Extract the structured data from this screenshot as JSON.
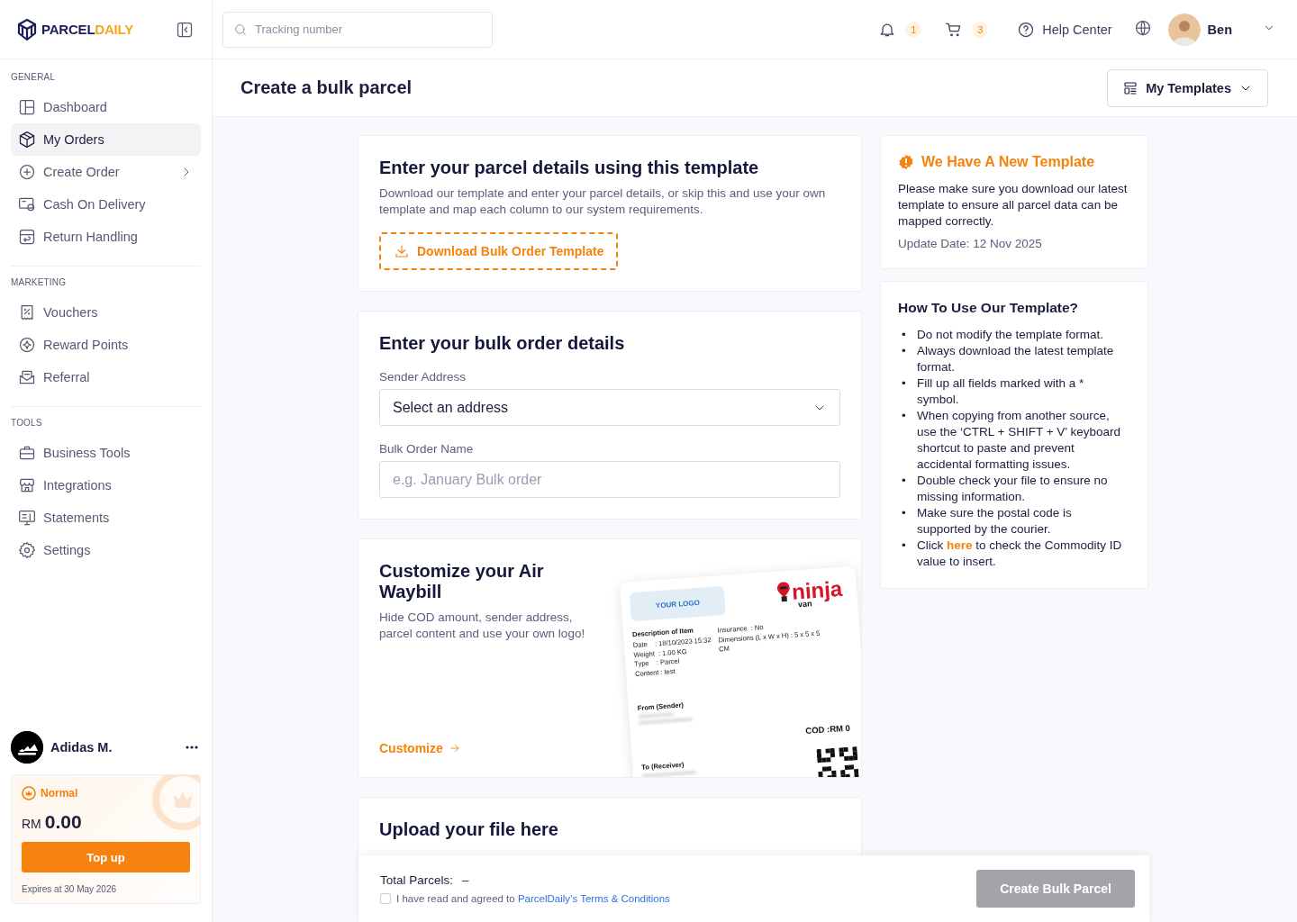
{
  "brand": {
    "primary": "PARCEL",
    "accent": "DAILY"
  },
  "search": {
    "placeholder": "Tracking number"
  },
  "topbar": {
    "notification_count": "1",
    "cart_count": "3",
    "help_label": "Help Center",
    "user_name": "Ben"
  },
  "sidebar": {
    "sections": [
      {
        "title": "GENERAL",
        "items": [
          {
            "label": "Dashboard",
            "selected": false,
            "expandable": false
          },
          {
            "label": "My Orders",
            "selected": true,
            "expandable": false
          },
          {
            "label": "Create Order",
            "selected": false,
            "expandable": true
          },
          {
            "label": "Cash On Delivery",
            "selected": false,
            "expandable": false
          },
          {
            "label": "Return Handling",
            "selected": false,
            "expandable": false
          }
        ]
      },
      {
        "title": "MARKETING",
        "items": [
          {
            "label": "Vouchers",
            "selected": false,
            "expandable": false
          },
          {
            "label": "Reward Points",
            "selected": false,
            "expandable": false
          },
          {
            "label": "Referral",
            "selected": false,
            "expandable": false
          }
        ]
      },
      {
        "title": "TOOLS",
        "items": [
          {
            "label": "Business Tools",
            "selected": false,
            "expandable": false
          },
          {
            "label": "Integrations",
            "selected": false,
            "expandable": false
          },
          {
            "label": "Statements",
            "selected": false,
            "expandable": false
          },
          {
            "label": "Settings",
            "selected": false,
            "expandable": false
          }
        ]
      }
    ]
  },
  "account": {
    "name": "Adidas M.",
    "tier": "Normal",
    "currency": "RM",
    "balance": "0.00",
    "top_up_button": "Top up",
    "expiry": "Expires at 30 May 2026"
  },
  "page": {
    "title": "Create a bulk parcel",
    "templates_button": "My Templates"
  },
  "template_card": {
    "title": "Enter your parcel details using this template",
    "description": "Download our template and enter your parcel details, or skip this and use your own template and map each column to our system requirements.",
    "download_button": "Download Bulk Order Template"
  },
  "details_card": {
    "title": "Enter your bulk order details",
    "fields": [
      {
        "kind": "select",
        "label": "Sender Address",
        "value": "Select an address"
      },
      {
        "kind": "text",
        "label": "Bulk Order Name",
        "placeholder": "e.g. January Bulk order"
      }
    ]
  },
  "waybill_card": {
    "title": "Customize your Air Waybill",
    "description": "Hide COD amount, sender address, parcel content and use your own logo!",
    "link": "Customize",
    "preview": {
      "logo_placeholder": "YOUR LOGO",
      "carrier": "ninja",
      "carrier_sub": "van",
      "section_title": "Description of Item",
      "details_left": [
        "Date    : 18/10/2023 15:32",
        "Weight  : 1.00 KG",
        "Type    : Parcel",
        "Content : test"
      ],
      "details_right": [
        "Insurance  : No",
        "Dimensions (L x W x H) : 5 x 5 x 5 CM"
      ],
      "sender_label": "From (Sender)",
      "cod": "COD :RM 0",
      "receiver_label": "To (Receiver)"
    }
  },
  "upload_card": {
    "title": "Upload your file here"
  },
  "notice": {
    "title": "We Have A New Template",
    "message": "Please make sure you download our latest template to ensure all parcel data can be mapped correctly.",
    "update_date": "Update Date: 12 Nov 2025"
  },
  "guide": {
    "title": "How To Use Our Template?",
    "items": [
      {
        "bullet": "•",
        "text": "Do not modify the template format."
      },
      {
        "bullet": "•",
        "text": "Always download the latest template format."
      },
      {
        "bullet": "•",
        "text": "Fill up all fields marked with a * symbol."
      },
      {
        "bullet": "•",
        "text": "When copying from another source, use the ‘CTRL + SHIFT + V’ keyboard shortcut to paste and prevent accidental formatting issues."
      },
      {
        "bullet": "•",
        "text": "Double check your file to ensure no missing information."
      },
      {
        "bullet": "•",
        "text": "Make sure the postal code is supported by the courier."
      },
      {
        "bullet": "•",
        "text": "Click ",
        "link": "here",
        "text_after": " to check the Commodity ID value to insert."
      }
    ]
  },
  "footer": {
    "total_label": "Total Parcels:",
    "total_value": "–",
    "agreement": {
      "checked": false,
      "text": "I have read and agreed to ",
      "link": "ParcelDaily’s Terms & Conditions"
    },
    "submit": {
      "label": "Create Bulk Parcel",
      "disabled": true
    }
  }
}
